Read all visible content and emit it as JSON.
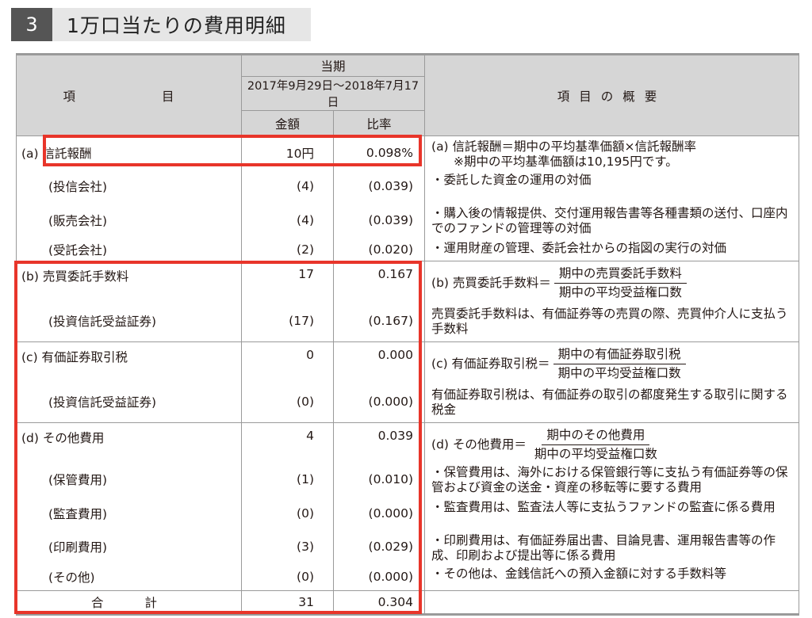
{
  "section": {
    "number": "3",
    "title": "1万口当たりの費用明細"
  },
  "header": {
    "item_col": "項　　目",
    "period_label": "当期",
    "period_range": "2017年9月29日～2018年7月17日",
    "amount_col": "金額",
    "ratio_col": "比率",
    "desc_col": "項目の概要"
  },
  "rows": {
    "a": {
      "label": "(a) 信託報酬",
      "amount": "10円",
      "ratio": "0.098%"
    },
    "a1": {
      "label": "(投信会社)",
      "amount": "(4)",
      "ratio": "(0.039)"
    },
    "a2": {
      "label": "(販売会社)",
      "amount": "(4)",
      "ratio": "(0.039)"
    },
    "a3": {
      "label": "(受託会社)",
      "amount": "(2)",
      "ratio": "(0.020)"
    },
    "b": {
      "label": "(b) 売買委託手数料",
      "amount": "17",
      "ratio": "0.167"
    },
    "b1": {
      "label": "(投資信託受益証券)",
      "amount": "(17)",
      "ratio": "(0.167)"
    },
    "c": {
      "label": "(c) 有価証券取引税",
      "amount": "0",
      "ratio": "0.000"
    },
    "c1": {
      "label": "(投資信託受益証券)",
      "amount": "(0)",
      "ratio": "(0.000)"
    },
    "d": {
      "label": "(d) その他費用",
      "amount": "4",
      "ratio": "0.039"
    },
    "d1": {
      "label": "(保管費用)",
      "amount": "(1)",
      "ratio": "(0.010)"
    },
    "d2": {
      "label": "(監査費用)",
      "amount": "(0)",
      "ratio": "(0.000)"
    },
    "d3": {
      "label": "(印刷費用)",
      "amount": "(3)",
      "ratio": "(0.029)"
    },
    "d4": {
      "label": "(その他)",
      "amount": "(0)",
      "ratio": "(0.000)"
    },
    "total": {
      "label": "合計",
      "amount": "31",
      "ratio": "0.304"
    }
  },
  "descriptions": {
    "a_main": "(a) 信託報酬＝期中の平均基準価額×信託報酬率",
    "a_note": "※期中の平均基準価額は10,195円です。",
    "a1": "・委託した資金の運用の対価",
    "a2": "・購入後の情報提供、交付運用報告書等各種書類の送付、口座内でのファンドの管理等の対価",
    "a3": "・運用財産の管理、委託会社からの指図の実行の対価",
    "b_lhs": "(b) 売買委託手数料＝",
    "b_num": "期中の売買委託手数料",
    "b_den": "期中の平均受益権口数",
    "b_text": "売買委託手数料は、有価証券等の売買の際、売買仲介人に支払う手数料",
    "c_lhs": "(c) 有価証券取引税＝",
    "c_num": "期中の有価証券取引税",
    "c_den": "期中の平均受益権口数",
    "c_text": "有価証券取引税は、有価証券の取引の都度発生する取引に関する税金",
    "d_lhs": "(d) その他費用＝",
    "d_num": "期中のその他費用",
    "d_den": "期中の平均受益権口数",
    "d1": "・保管費用は、海外における保管銀行等に支払う有価証券等の保管および資金の送金・資産の移転等に要する費用",
    "d2": "・監査費用は、監査法人等に支払うファンドの監査に係る費用",
    "d3": "・印刷費用は、有価証券届出書、目論見書、運用報告書等の作成、印刷および提出等に係る費用",
    "d4": "・その他は、金銭信託への預入金額に対する手数料等"
  },
  "colors": {
    "highlight": "#e8352a",
    "header_bg": "#d6d6d6",
    "title_num_bg": "#555555"
  }
}
